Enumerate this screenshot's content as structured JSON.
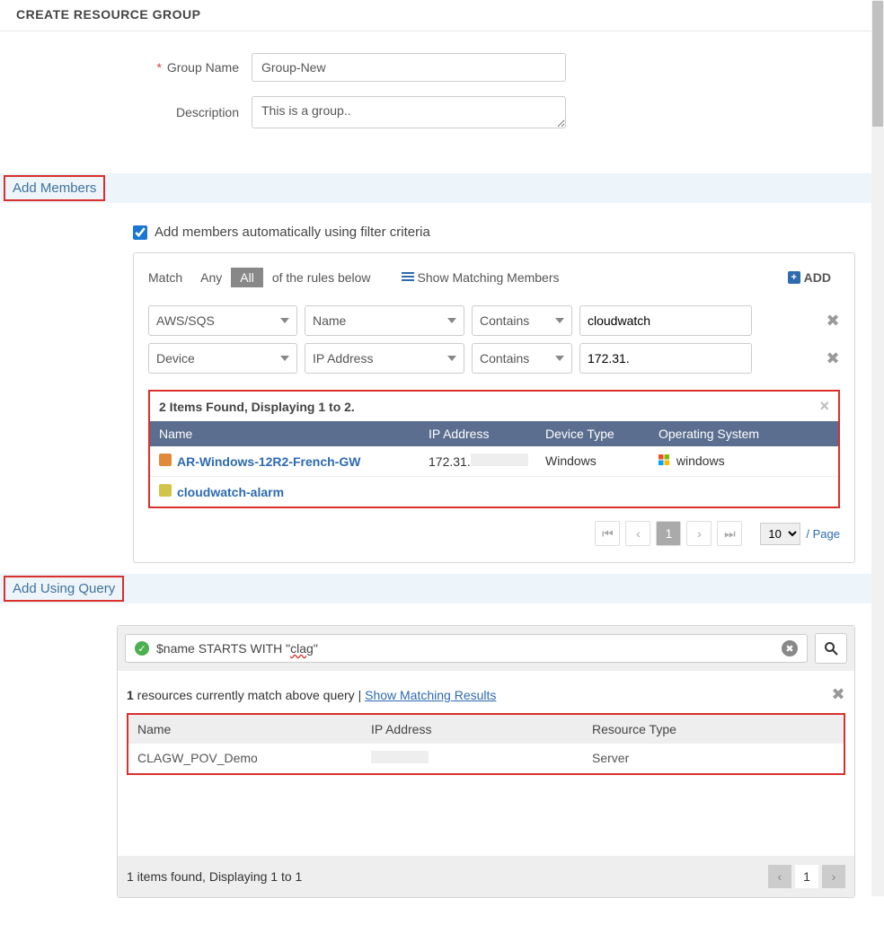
{
  "header": {
    "title": "CREATE RESOURCE GROUP"
  },
  "form": {
    "group_name_label": "Group Name",
    "group_name_value": "Group-New",
    "description_label": "Description",
    "description_value": "This is a group.."
  },
  "sections": {
    "add_members": "Add Members",
    "add_using_query": "Add Using Query"
  },
  "members": {
    "checkbox_label": "Add members automatically using filter criteria",
    "match_label": "Match",
    "any_label": "Any",
    "all_label": "All",
    "of_rules_label": "of the rules below",
    "show_matching_members": "Show Matching Members",
    "add_label": "ADD",
    "rules": [
      {
        "source": "AWS/SQS",
        "field": "Name",
        "op": "Contains",
        "value": "cloudwatch"
      },
      {
        "source": "Device",
        "field": "IP Address",
        "op": "Contains",
        "value": "172.31."
      }
    ],
    "results_summary": "2 Items Found, Displaying 1 to 2.",
    "columns": {
      "name": "Name",
      "ip": "IP Address",
      "dtype": "Device Type",
      "os": "Operating System"
    },
    "rows": [
      {
        "name": "AR-Windows-12R2-French-GW",
        "ip": "172.31.",
        "dtype": "Windows",
        "os": "windows"
      },
      {
        "name": "cloudwatch-alarm",
        "ip": "",
        "dtype": "",
        "os": ""
      }
    ],
    "pager": {
      "page": "1",
      "size": "10",
      "per_page_label": "/ Page"
    }
  },
  "query": {
    "expr_prefix": "$name STARTS WITH  \"",
    "expr_wavy": "clag",
    "expr_suffix": "\"",
    "match_count": "1",
    "match_text": " resources currently match above query | ",
    "show_link": "Show Matching Results",
    "columns": {
      "name": "Name",
      "ip": "IP Address",
      "rtype": "Resource Type"
    },
    "rows": [
      {
        "name": "CLAGW_POV_Demo",
        "ip": "",
        "rtype": "Server"
      }
    ],
    "footer_text": "1 items found, Displaying 1 to 1",
    "pager": {
      "page": "1"
    }
  }
}
